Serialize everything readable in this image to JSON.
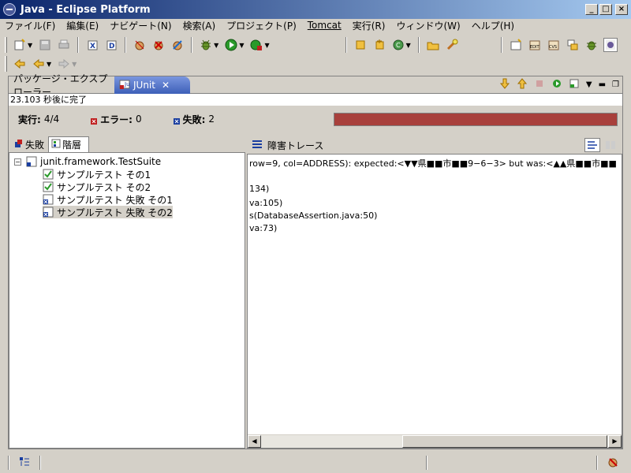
{
  "window": {
    "title": "Java - Eclipse Platform"
  },
  "menu": [
    "ファイル(F)",
    "編集(E)",
    "ナビゲート(N)",
    "検索(A)",
    "プロジェクト(P)",
    "Tomcat",
    "実行(R)",
    "ウィンドウ(W)",
    "ヘルプ(H)"
  ],
  "tabs": {
    "package_explorer": "パッケージ・エクスプローラー",
    "junit": "JUnit"
  },
  "junit": {
    "finished": "23.103 秒後に完了",
    "runs_label": "実行:",
    "runs_value": "4/4",
    "errors_label": "エラー:",
    "errors_value": "0",
    "failures_label": "失敗:",
    "failures_value": "2",
    "progress_fraction": 1.0,
    "progress_color": "#a8403c"
  },
  "left_tabs": {
    "failures": "失敗",
    "hierarchy": "階層"
  },
  "tree": {
    "root": "junit.framework.TestSuite",
    "items": [
      {
        "label": "サンプルテスト その1",
        "status": "pass"
      },
      {
        "label": "サンプルテスト その2",
        "status": "pass"
      },
      {
        "label": "サンプルテスト 失敗 その1",
        "status": "fail"
      },
      {
        "label": "サンプルテスト 失敗 その2",
        "status": "fail"
      }
    ]
  },
  "trace": {
    "title": "障害トレース",
    "lines": [
      "row=9, col=ADDRESS): expected:<▼▼県■■市■■9−6−3> but was:<▲▲県■■市■■",
      "134)",
      "va:105)",
      "s(DatabaseAssertion.java:50)",
      "va:73)"
    ]
  }
}
